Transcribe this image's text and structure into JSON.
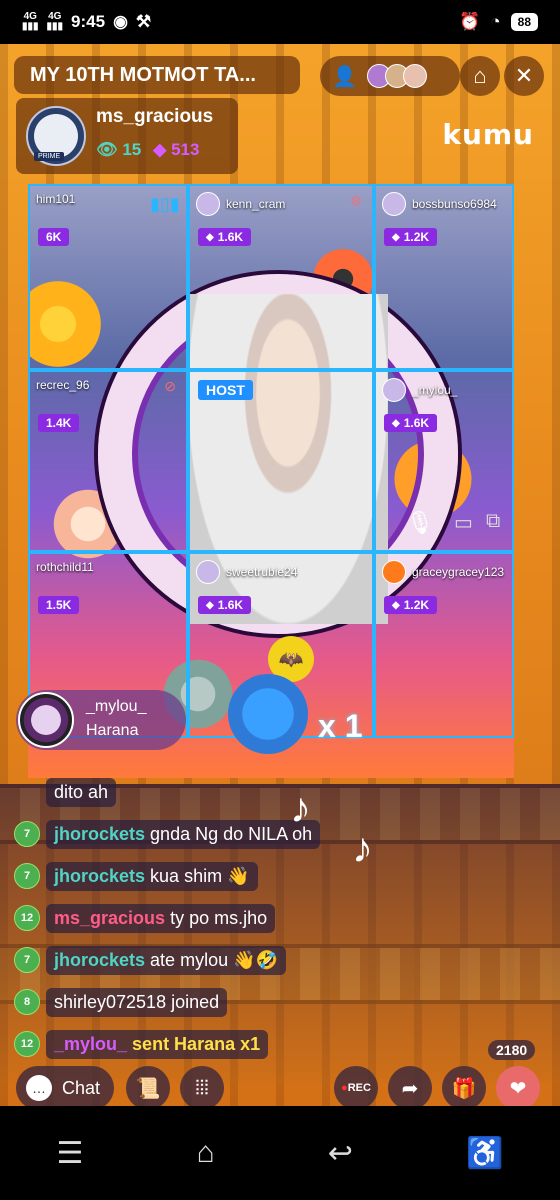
{
  "status": {
    "network_1": "4G",
    "network_2": "4G",
    "time": "9:45",
    "battery": "88"
  },
  "header": {
    "title": "MY 10TH MOTMOT TA...",
    "buttons": [
      "user-icon",
      "home-icon",
      "close-icon"
    ]
  },
  "host": {
    "name": "ms_gracious",
    "badge": "PRIME",
    "views": "15",
    "gems": "513"
  },
  "brand": "kumu",
  "grid": [
    {
      "user": "him101",
      "gems": "6K",
      "label": ""
    },
    {
      "user": "kenn_cram",
      "gems": "1.6K",
      "label": ""
    },
    {
      "user": "bossbunso6984",
      "gems": "1.2K",
      "label": ""
    },
    {
      "user": "recrec_96",
      "gems": "1.4K",
      "label": ""
    },
    {
      "user": "",
      "gems": "",
      "label": "HOST"
    },
    {
      "user": "_mylou_",
      "gems": "1.6K",
      "label": ""
    },
    {
      "user": "rothchild11",
      "gems": "1.5K",
      "label": ""
    },
    {
      "user": "sweetrubie24",
      "gems": "1.6K",
      "label": ""
    },
    {
      "user": "graceygracey123",
      "gems": "1.2K",
      "label": ""
    }
  ],
  "gift_banner": {
    "user": "_mylou_",
    "gift": "Harana",
    "count": "x 1"
  },
  "chat": [
    {
      "level": "",
      "user": "",
      "text": "dito ah",
      "type": "plain"
    },
    {
      "level": "7",
      "user": "jhorockets",
      "text": "gnda Ng do NILA oh",
      "type": "normal"
    },
    {
      "level": "7",
      "user": "jhorockets",
      "text": "kua shim 👋",
      "type": "normal"
    },
    {
      "level": "12",
      "user": "ms_gracious",
      "text": "ty po ms.jho",
      "type": "host"
    },
    {
      "level": "7",
      "user": "jhorockets",
      "text": "ate mylou 👋🤣",
      "type": "normal"
    },
    {
      "level": "8",
      "user": "",
      "text": "shirley072518 joined",
      "type": "join"
    },
    {
      "level": "12",
      "user": "_mylou_",
      "text": "sent Harana x1",
      "type": "gift"
    }
  ],
  "bottom": {
    "chat_label": "Chat",
    "rec_label": "REC",
    "heart_count": "2180"
  }
}
